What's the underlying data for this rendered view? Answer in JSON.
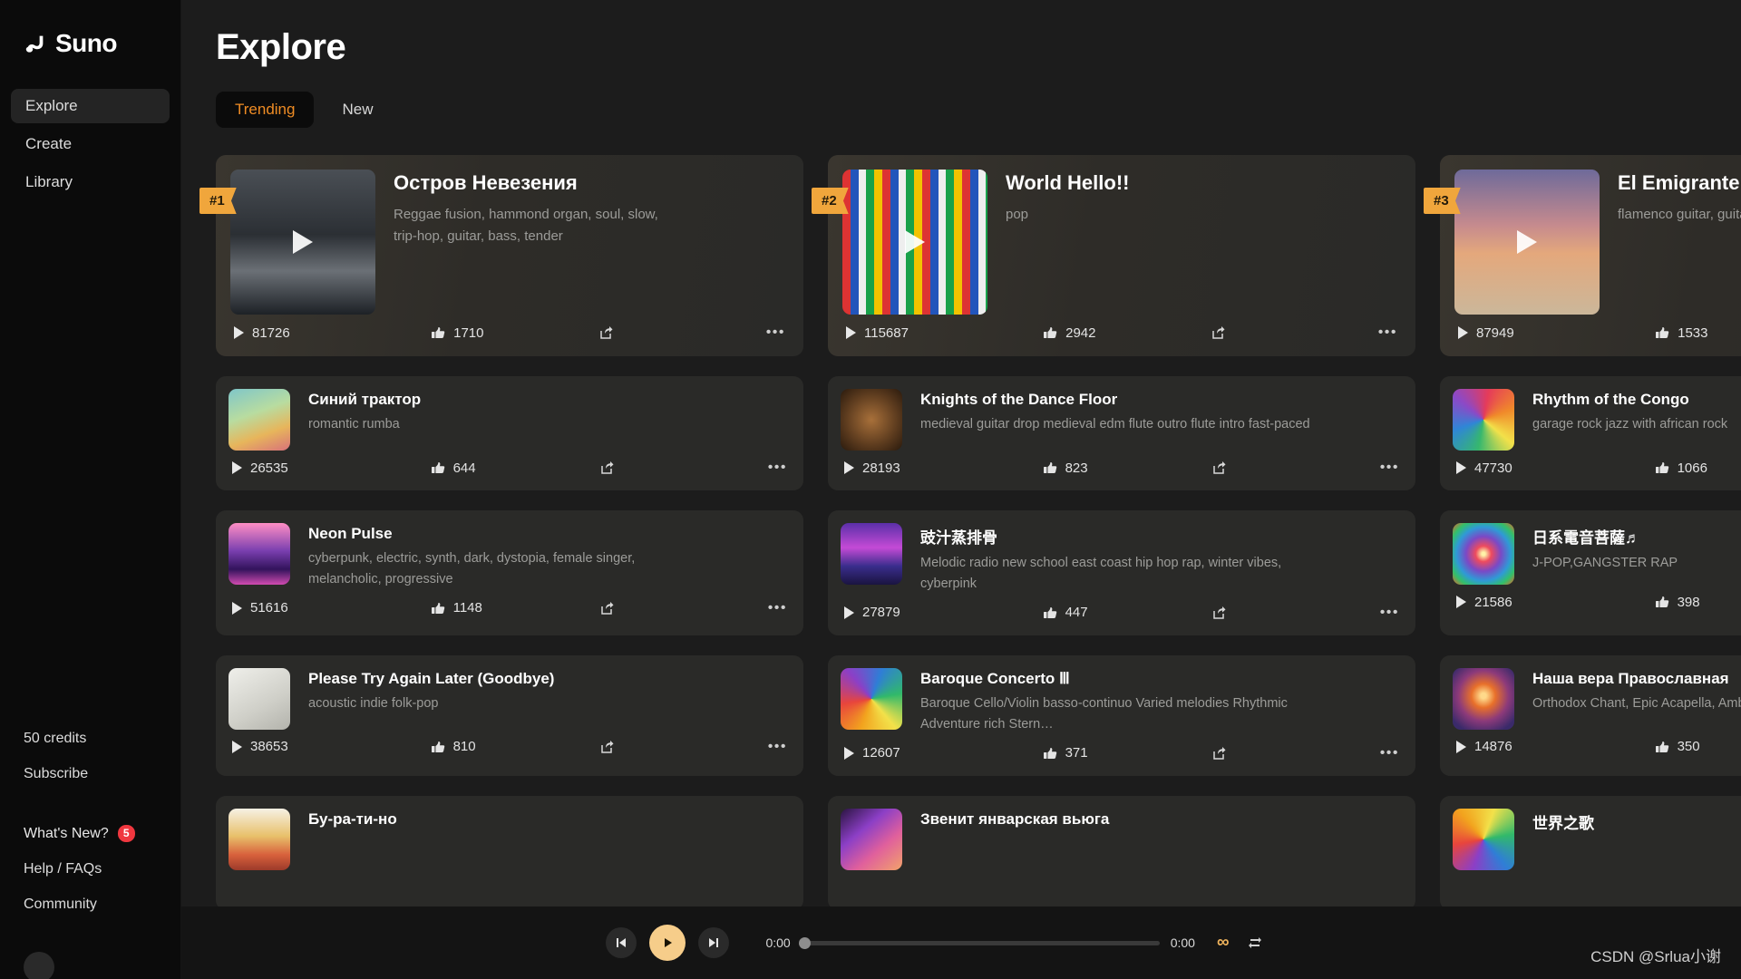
{
  "brand": {
    "name": "Suno",
    "logo_icon": "suno-note-logo"
  },
  "sidebar": {
    "nav": [
      {
        "label": "Explore",
        "active": true
      },
      {
        "label": "Create",
        "active": false
      },
      {
        "label": "Library",
        "active": false
      }
    ],
    "credits": "50 credits",
    "subscribe": "Subscribe",
    "whats_new": "What's New?",
    "whats_new_count": "5",
    "help": "Help / FAQs",
    "community": "Community"
  },
  "header": {
    "title": "Explore"
  },
  "tabs": [
    {
      "label": "Trending",
      "active": true
    },
    {
      "label": "New",
      "active": false
    }
  ],
  "colors": {
    "accent": "#ef8c24",
    "rank_flag": "#f0a63c",
    "badge_red": "#f0373f",
    "player_play": "#f6cd8a",
    "page_bg": "#1c1c1c",
    "sidebar_bg": "#0b0b0b",
    "card_bg": "#2a2a28"
  },
  "cards": [
    {
      "rank": "#1",
      "featured": true,
      "title": "Остров Невезения",
      "desc": "Reggae fusion, hammond organ, soul, slow, trip-hop, guitar, bass, tender",
      "plays": "81726",
      "likes": "1710",
      "art": "dark-forest-moonlight"
    },
    {
      "rank": "#2",
      "featured": true,
      "title": "World Hello!!",
      "desc": "pop",
      "plays": "115687",
      "likes": "2942",
      "art": "world-flags-collage"
    },
    {
      "rank": "#3",
      "featured": true,
      "title": "El Emigrante",
      "desc": "flamenco guitar, guitar, quarter note,  Sad",
      "plays": "87949",
      "likes": "1533",
      "art": "acoustic-guitar-sunset-desert"
    },
    {
      "rank": "",
      "featured": false,
      "title": "Синий трактор",
      "desc": "romantic rumba",
      "plays": "26535",
      "likes": "644",
      "art": "colorful-forest-cats"
    },
    {
      "rank": "",
      "featured": false,
      "title": "Knights of the Dance Floor",
      "desc": "medieval guitar drop medieval edm flute outro flute intro fast-paced",
      "plays": "28193",
      "likes": "823",
      "art": "ornate-persian-carpet"
    },
    {
      "rank": "",
      "featured": false,
      "title": "Rhythm of the Congo",
      "desc": "garage rock jazz with african rock",
      "plays": "47730",
      "likes": "1066",
      "art": "psychedelic-swirl-rainbow"
    },
    {
      "rank": "",
      "featured": false,
      "title": "Neon Pulse",
      "desc": "cyberpunk, electric, synth, dark, dystopia, female singer, melancholic, progressive",
      "plays": "51616",
      "likes": "1148",
      "art": "neon-pink-city-skyline"
    },
    {
      "rank": "",
      "featured": false,
      "title": "豉汁蒸排骨",
      "desc": "Melodic radio new school east coast hip hop rap, winter vibes, cyberpink",
      "plays": "27879",
      "likes": "447",
      "art": "neon-cyberpunk-street"
    },
    {
      "rank": "",
      "featured": false,
      "title": "日系電音菩薩♬",
      "desc": "J-POP,GANGSTER RAP",
      "plays": "21586",
      "likes": "398",
      "art": "mandala-rainbow-circle"
    },
    {
      "rank": "",
      "featured": false,
      "title": "Please Try Again Later (Goodbye)",
      "desc": "acoustic indie folk-pop",
      "plays": "38653",
      "likes": "810",
      "art": "sketch-bird-with-guitar"
    },
    {
      "rank": "",
      "featured": false,
      "title": "Baroque Concerto Ⅲ",
      "desc": "Baroque Cello/Violin basso-continuo Varied melodies Rhythmic Adventure rich Stern…",
      "plays": "12607",
      "likes": "371",
      "art": "rainbow-paint-swirl"
    },
    {
      "rank": "",
      "featured": false,
      "title": "Наша вера Православная",
      "desc": "Orthodox Chant, Epic Acapella, Ambient, Military Vibe",
      "plays": "14876",
      "likes": "350",
      "art": "orthodox-cross-fractal"
    },
    {
      "rank": "",
      "featured": false,
      "title": "Бу-ра-ти-но",
      "desc": "",
      "plays": "",
      "likes": "",
      "art": "folk-pattern-warm"
    },
    {
      "rank": "",
      "featured": false,
      "title": "Звенит январская вьюга",
      "desc": "",
      "plays": "",
      "likes": "",
      "art": "purple-swirl-feather"
    },
    {
      "rank": "",
      "featured": false,
      "title": "世界之歌",
      "desc": "",
      "plays": "",
      "likes": "",
      "art": "rainbow-arc-pattern"
    }
  ],
  "player": {
    "elapsed": "0:00",
    "duration": "0:00",
    "progress_percent": 0,
    "prev_icon": "skip-previous-icon",
    "play_icon": "play-icon",
    "next_icon": "skip-next-icon",
    "loop_icon": "infinity-icon",
    "shuffle_icon": "repeat-icon"
  },
  "watermark": "CSDN @Srlua小谢"
}
